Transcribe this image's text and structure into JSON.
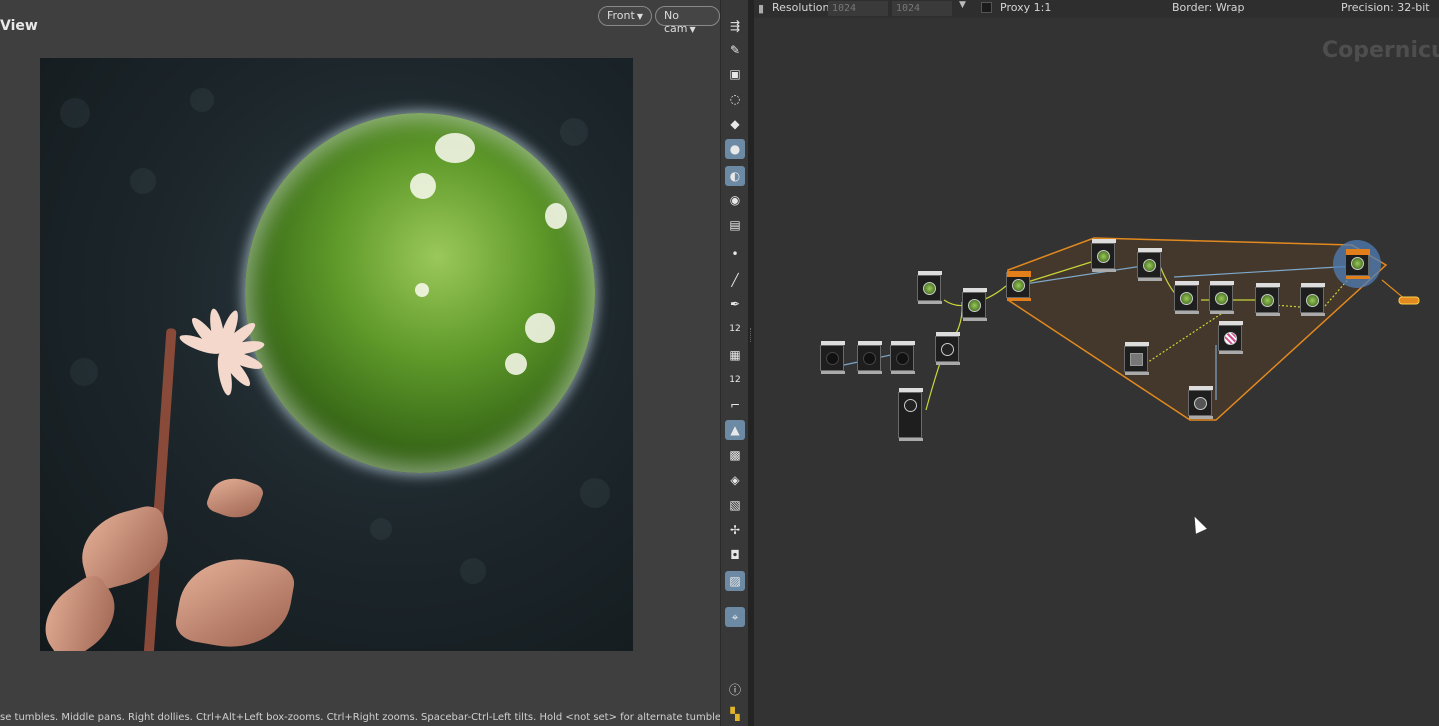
{
  "viewer": {
    "title": "View",
    "camera_button": "Front",
    "cam_button": "No cam",
    "status_text": "se tumbles. Middle pans. Right dollies. Ctrl+Alt+Left box-zooms. Ctrl+Right zooms. Spacebar-Ctrl-Left tilts. Hold <not set> for alternate tumble."
  },
  "network": {
    "resolution_label": "Resolution",
    "res_w": "1024",
    "res_h": "1024",
    "proxy": "Proxy 1:1",
    "border": "Border: Wrap",
    "precision": "Precision: 32-bit",
    "context_label": "Copernicus"
  },
  "colors": {
    "accent": "#e27f1a",
    "selected_ring": "#4f7db7",
    "active_tool": "#6d8aa5"
  },
  "toolbar_icons": [
    "select-icon",
    "pose-icon",
    "lock-icon",
    "lightbulb-outline-icon",
    "diamond-icon",
    "light-icon",
    "shading-icon",
    "eye-icon",
    "camera-icon",
    "dot-icon",
    "brush-icon",
    "pen-icon",
    "number-12-icon",
    "layers-icon",
    "number-12-stack-icon",
    "corner-icon",
    "grid-icon",
    "checker-icon",
    "snap-icon",
    "image-icon",
    "move-icon",
    "disk-icon",
    "picture-icon",
    "pin-icon",
    "info-icon",
    "color-icon"
  ]
}
